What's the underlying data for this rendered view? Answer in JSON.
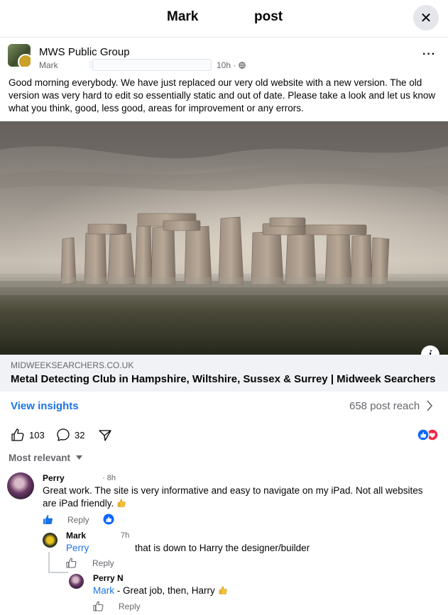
{
  "header": {
    "title_left": "Mark",
    "title_right": "post",
    "close_icon": "✕"
  },
  "post": {
    "group_name": "MWS Public Group",
    "author": "Mark",
    "time": "10h · ",
    "text": "Good morning everybody. We have just replaced our very old website with a new version. The old version was very hard to edit so essentially static and out of date. Please take a look and let us know what you think, good, less good, areas for improvement or any errors.",
    "link_domain": "MIDWEEKSEARCHERS.CO.UK",
    "link_title": "Metal Detecting Club in Hampshire, Wiltshire, Sussex & Surrey | Midweek Searchers",
    "info_glyph": "i"
  },
  "insights": {
    "label": "View insights",
    "reach": "658 post reach"
  },
  "actions": {
    "likes": "103",
    "comments": "32"
  },
  "sort": {
    "label": "Most relevant"
  },
  "comments": [
    {
      "name": "Perry",
      "time": "· 8h",
      "text": "Great work. The site is very informative and easy to navigate on my iPad. Not all websites are iPad friendly. ",
      "reply": "Reply"
    },
    {
      "name": "Mark",
      "time": "7h",
      "mention": "Perry",
      "text": "that is down to Harry the designer/builder",
      "reply": "Reply"
    },
    {
      "name": "Perry N",
      "mention": "Mark",
      "text": " - Great job, then, Harry ",
      "reply": "Reply"
    }
  ],
  "colors": {
    "accent": "#1b74e4",
    "muted": "#65676b",
    "like_blue": "#0866ff",
    "love_red": "#f02849"
  }
}
